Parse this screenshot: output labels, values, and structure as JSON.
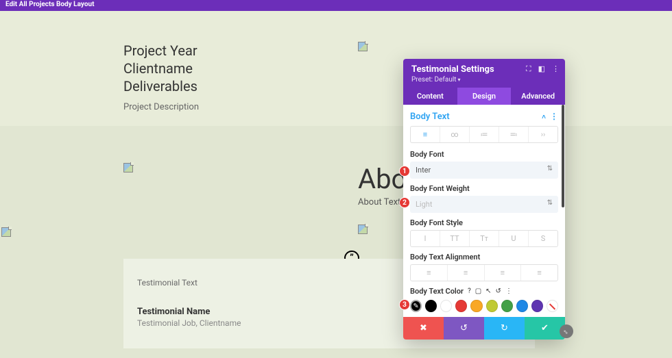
{
  "topbar": {
    "title": "Edit All Projects Body Layout"
  },
  "project": {
    "line1": "Project Year",
    "line2": "Clientname",
    "line3": "Deliverables",
    "desc": "Project Description"
  },
  "about": {
    "heading": "About",
    "text": "About Text"
  },
  "testimonial": {
    "text": "Testimonial Text",
    "name": "Testimonial Name",
    "job": "Testimonial Job, Clientname",
    "quote_glyph": "”"
  },
  "panel": {
    "title": "Testimonial Settings",
    "preset": "Preset: Default",
    "tabs": {
      "content": "Content",
      "design": "Design",
      "advanced": "Advanced"
    },
    "section": "Body Text",
    "tt_icons": [
      "≡",
      "∞",
      "≔",
      "≕",
      "››"
    ],
    "body_font": {
      "label": "Body Font",
      "value": "Inter"
    },
    "body_weight": {
      "label": "Body Font Weight",
      "value": "Light"
    },
    "body_style": {
      "label": "Body Font Style",
      "icons": [
        "I",
        "TT",
        "Tᴛ",
        "U",
        "S"
      ]
    },
    "body_align": {
      "label": "Body Text Alignment"
    },
    "body_color": {
      "label": "Body Text Color"
    },
    "swatches": [
      "#000000",
      "#ffffff",
      "#e53935",
      "#f9a825",
      "#c0ca33",
      "#43a047",
      "#1e88e5",
      "#5e35b1"
    ]
  },
  "steps": {
    "s1": "1",
    "s2": "2",
    "s3": "3"
  }
}
